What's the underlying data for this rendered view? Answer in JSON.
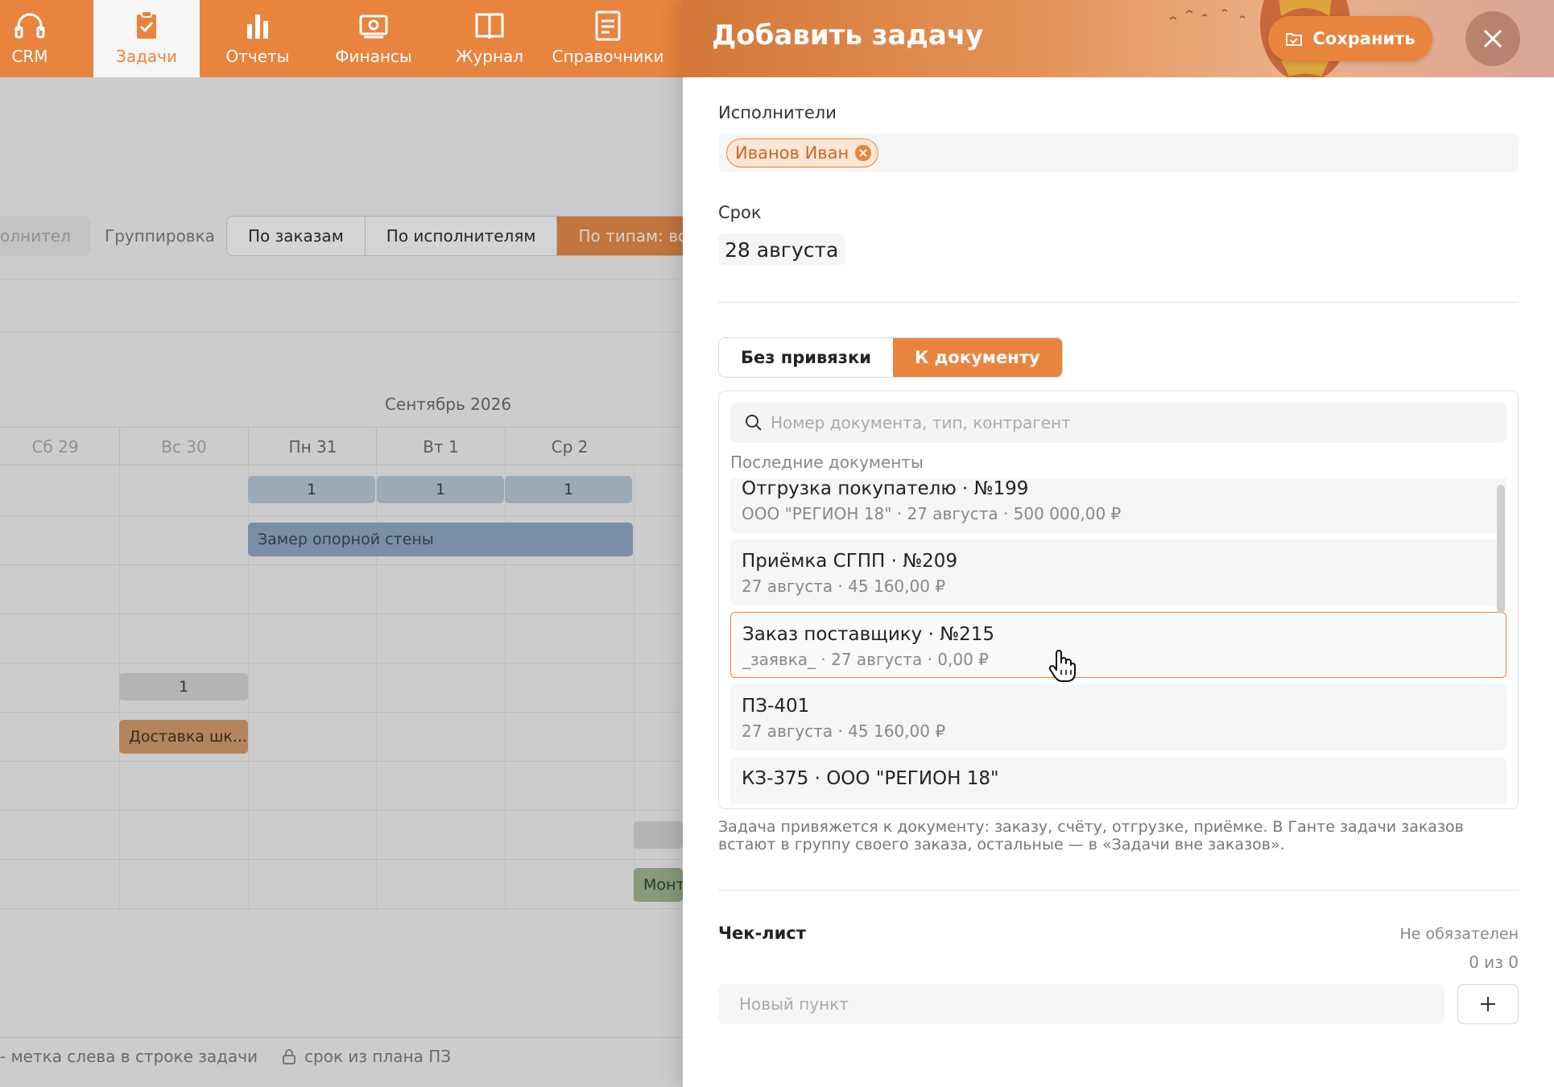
{
  "nav": {
    "items": [
      {
        "label": "CRM",
        "icon": "headset-icon"
      },
      {
        "label": "Задачи",
        "icon": "clipboard-check-icon",
        "active": true
      },
      {
        "label": "Отчеты",
        "icon": "bar-chart-icon"
      },
      {
        "label": "Финансы",
        "icon": "money-icon"
      },
      {
        "label": "Журнал",
        "icon": "book-icon"
      },
      {
        "label": "Справочники",
        "icon": "document-icon"
      }
    ]
  },
  "toolbar": {
    "cut_label": "олнител",
    "grouping_label": "Группировка",
    "options": [
      "По заказам",
      "По исполнителям",
      "По типам: вс"
    ]
  },
  "gantt": {
    "month": "Сентябрь 2026",
    "days": [
      "Сб 29",
      "Вс 30",
      "Пн 31",
      "Вт 1",
      "Ср 2"
    ],
    "counts": [
      "1",
      "1",
      "1",
      "1"
    ],
    "tasks": [
      "Замер опорной стены",
      "Доставка шк...",
      "Монт"
    ],
    "footer_left": "- метка слева в строке задачи",
    "footer_right": "срок из плана ПЗ"
  },
  "drawer": {
    "title": "Добавить задачу",
    "save_label": "Сохранить",
    "assignees_label": "Исполнители",
    "assignee": "Иванов Иван",
    "due_label": "Срок",
    "due_value": "28 августа",
    "binding": {
      "none": "Без привязки",
      "doc": "К документу"
    },
    "search_placeholder": "Номер документа, тип, контрагент",
    "recent_label": "Последние документы",
    "documents": [
      {
        "title": "Отгрузка покупателю · №199",
        "sub": "ООО \"РЕГИОН 18\" · 27 августа · 500 000,00 ₽"
      },
      {
        "title": "Приёмка СГПП · №209",
        "sub": "27 августа · 45 160,00 ₽"
      },
      {
        "title": "Заказ поставщику · №215",
        "sub": "_заявка_ · 27 августа · 0,00 ₽"
      },
      {
        "title": "ПЗ-401",
        "sub": "27 августа · 45 160,00 ₽"
      },
      {
        "title": "КЗ-375 · ООО \"РЕГИОН 18\"",
        "sub": ""
      }
    ],
    "hint": "Задача привяжется к документу: заказу, счёту, отгрузке, приёмке. В Ганте задачи заказов встают в группу своего заказа, остальные — в «Задачи вне заказов».",
    "checklist_title": "Чек-лист",
    "checklist_optional": "Не обязателен",
    "checklist_count": "0 из 0",
    "new_item_placeholder": "Новый пункт"
  },
  "colors": {
    "accent": "#e8843e"
  }
}
